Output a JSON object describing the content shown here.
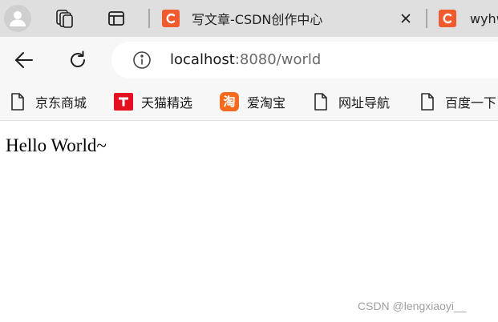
{
  "tabs": [
    {
      "title": "写文章-CSDN创作中心",
      "favicon": "csdn-c-icon",
      "active": true
    },
    {
      "title": "wyhw",
      "favicon": "csdn-c-icon",
      "active": false
    }
  ],
  "address_bar": {
    "url_host": "localhost",
    "url_rest": ":8080/world"
  },
  "bookmarks": [
    {
      "label": "京东商城",
      "icon": "document-icon"
    },
    {
      "label": "天猫精选",
      "icon": "tmall-icon"
    },
    {
      "label": "爱淘宝",
      "icon": "taobao-icon",
      "icon_text": "淘"
    },
    {
      "label": "网址导航",
      "icon": "document-icon"
    },
    {
      "label": "百度一下",
      "icon": "document-icon"
    }
  ],
  "page": {
    "text": "Hello World~"
  },
  "watermark": "CSDN @lengxiaoyi__",
  "colors": {
    "tab_strip": "#dfdfdf",
    "toolbar": "#f7f7f7",
    "csdn_brand": "#f05a2f",
    "tmall_red": "#e5101f",
    "taobao_orange": "#f56a1e"
  }
}
